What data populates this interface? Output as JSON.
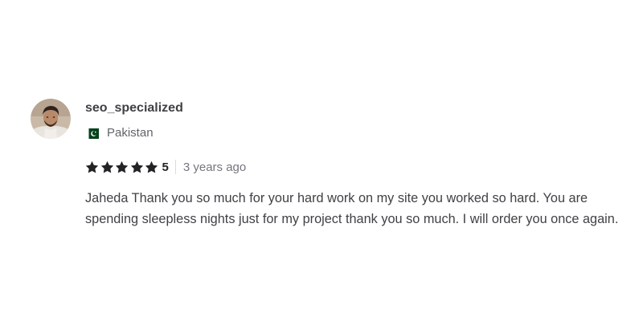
{
  "review": {
    "username": "seo_specialized",
    "country": "Pakistan",
    "country_flag_icon": "pakistan-flag-icon",
    "rating_value": "5",
    "stars_filled": 5,
    "stars_total": 5,
    "time_ago": "3 years ago",
    "text": "Jaheda Thank you so much for your hard work on my site you worked so hard. You are spending sleepless nights just for my project thank you so much. I will order you once again.",
    "star_color": "#222325",
    "avatar_icon": "user-avatar"
  }
}
